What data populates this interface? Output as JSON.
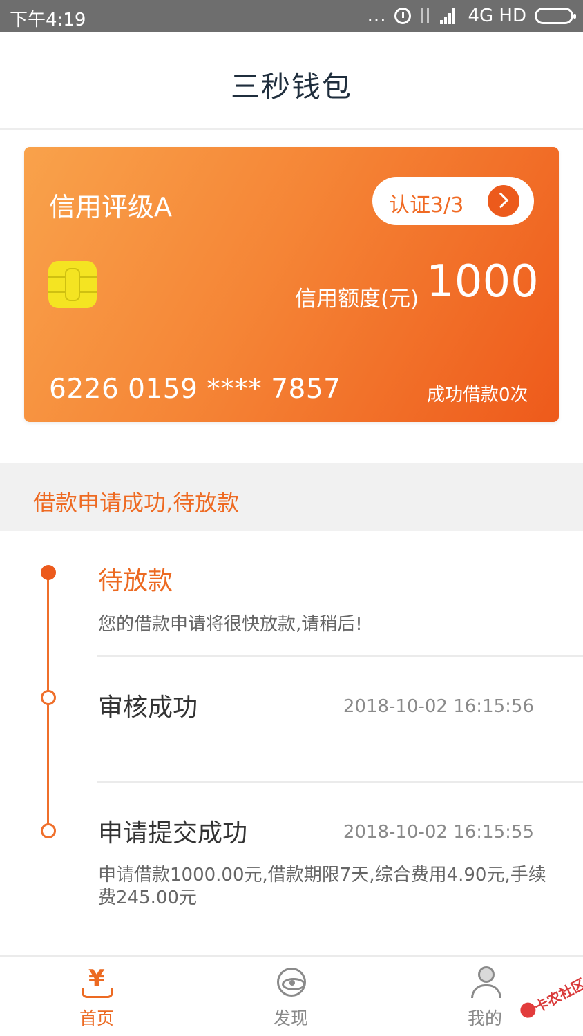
{
  "status_bar": {
    "time": "下午4:19",
    "dots": "...",
    "network": "4G HD"
  },
  "header": {
    "title": "三秒钱包"
  },
  "card": {
    "rating": "信用评级A",
    "verify_label": "认证3/3",
    "limit_label": "信用额度(元)",
    "limit_value": "1000",
    "card_number": "6226 0159 **** 7857",
    "loan_count": "成功借款0次"
  },
  "notice": {
    "text": "借款申请成功,待放款"
  },
  "timeline": [
    {
      "title": "待放款",
      "description": "您的借款申请将很快放款,请稍后!",
      "time": ""
    },
    {
      "title": "审核成功",
      "description": "",
      "time": "2018-10-02 16:15:56"
    },
    {
      "title": "申请提交成功",
      "description": "申请借款1000.00元,借款期限7天,综合费用4.90元,手续费245.00元",
      "time": "2018-10-02 16:15:55"
    }
  ],
  "nav": [
    {
      "label": "首页",
      "icon": "yen-icon",
      "active": true
    },
    {
      "label": "发现",
      "icon": "eye-icon",
      "active": false
    },
    {
      "label": "我的",
      "icon": "user-icon",
      "active": false
    }
  ],
  "watermark": {
    "text": "卡农社区"
  },
  "colors": {
    "accent": "#ec6a22",
    "card_start": "#f9a24b",
    "card_end": "#ee5a1b",
    "chip": "#f4e422"
  }
}
